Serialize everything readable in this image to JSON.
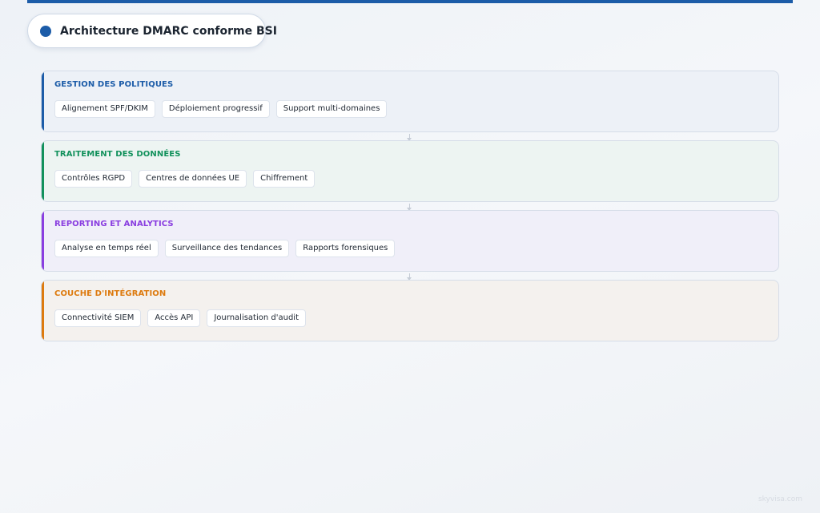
{
  "title": "Architecture DMARC conforme BSI",
  "colors": {
    "primary": "#1c5ca8",
    "policy": "#1c5ca8",
    "data": "#12915c",
    "reporting": "#8a3ee0",
    "integration": "#dd7a0e"
  },
  "layers": [
    {
      "title": "GESTION DES POLITIQUES",
      "items": [
        "Alignement SPF/DKIM",
        "Déploiement progressif",
        "Support multi-domaines"
      ]
    },
    {
      "title": "TRAITEMENT DES DONNÉES",
      "items": [
        "Contrôles RGPD",
        "Centres de données UE",
        "Chiffrement"
      ]
    },
    {
      "title": "REPORTING ET ANALYTICS",
      "items": [
        "Analyse en temps réel",
        "Surveillance des tendances",
        "Rapports forensiques"
      ]
    },
    {
      "title": "COUCHE D'INTÉGRATION",
      "items": [
        "Connectivité SIEM",
        "Accès API",
        "Journalisation d'audit"
      ]
    }
  ],
  "watermark": "skyvisa.com"
}
